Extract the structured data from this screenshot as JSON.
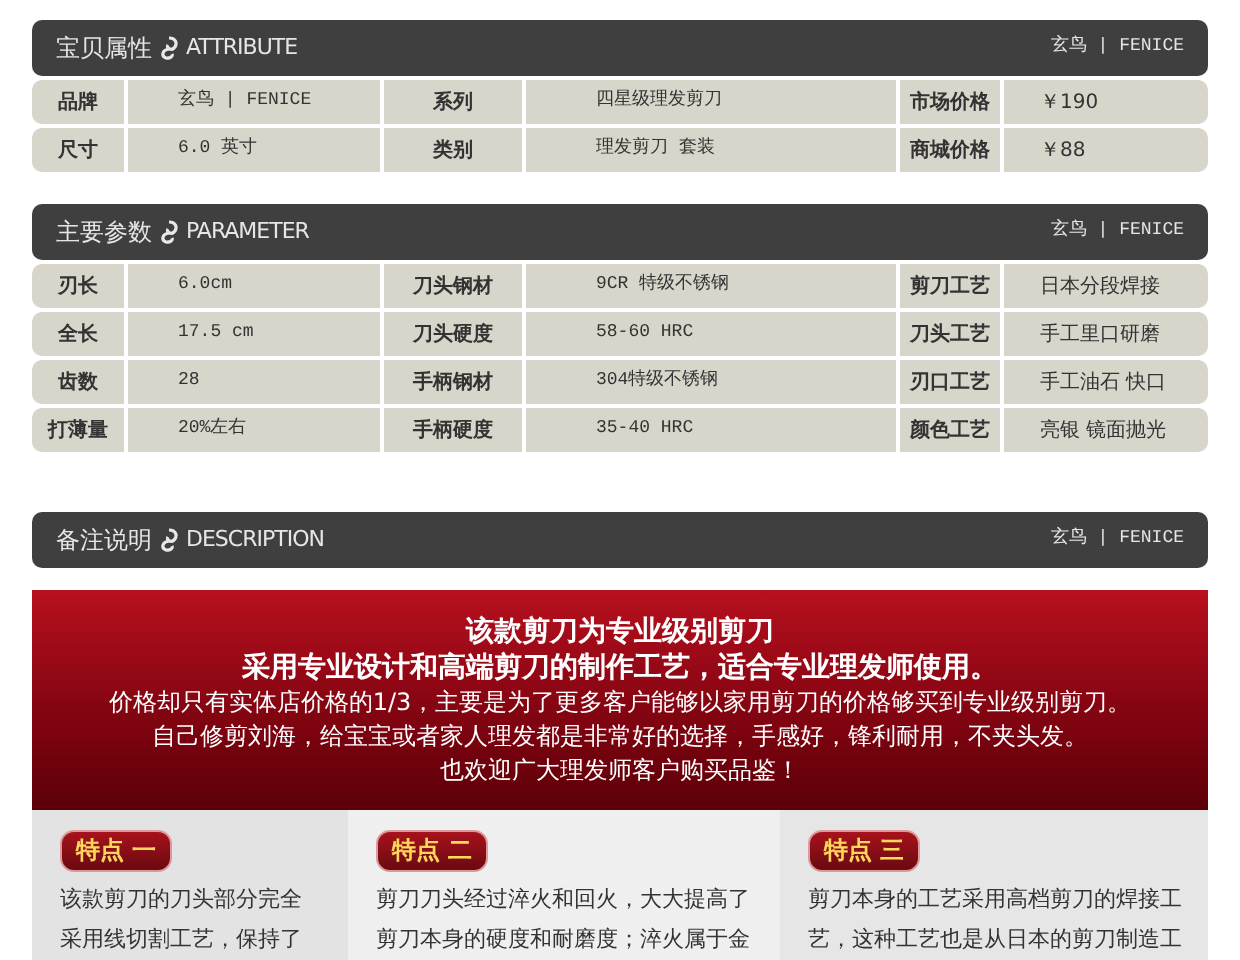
{
  "sections": [
    {
      "title_cn": "宝贝属性",
      "title_en": "ATTRIBUTE",
      "brand": "玄鸟 | FENICE",
      "rows": [
        {
          "cells": [
            "品牌",
            "玄鸟 | FENICE",
            "系列",
            "四星级理发剪刀",
            "市场价格",
            "￥190"
          ]
        },
        {
          "cells": [
            "尺寸",
            "6.0 英寸",
            "类别",
            "理发剪刀 套装",
            "商城价格",
            "￥88"
          ]
        }
      ]
    },
    {
      "title_cn": "主要参数",
      "title_en": "PARAMETER",
      "brand": "玄鸟 | FENICE",
      "rows": [
        {
          "cells": [
            "刃长",
            "6.0cm",
            "刀头钢材",
            "9CR 特级不锈钢",
            "剪刀工艺",
            "日本分段焊接"
          ]
        },
        {
          "cells": [
            "全长",
            "17.5 cm",
            "刀头硬度",
            "58-60 HRC",
            "刀头工艺",
            "手工里口研磨"
          ]
        },
        {
          "cells": [
            "齿数",
            "28",
            "手柄钢材",
            "304特级不锈钢",
            "刃口工艺",
            "手工油石 快口"
          ]
        },
        {
          "cells": [
            "打薄量",
            "20%左右",
            "手柄硬度",
            "35-40 HRC",
            "颜色工艺",
            "亮银 镜面抛光"
          ]
        }
      ]
    },
    {
      "title_cn": "备注说明",
      "title_en": "DESCRIPTION",
      "brand": "玄鸟 | FENICE"
    }
  ],
  "banner": {
    "headlines": [
      "该款剪刀为专业级别剪刀",
      "采用专业设计和高端剪刀的制作工艺，适合专业理发师使用。"
    ],
    "lines": [
      "价格却只有实体店价格的1/3，主要是为了更多客户能够以家用剪刀的价格够买到专业级别剪刀。",
      "自己修剪刘海，给宝宝或者家人理发都是非常好的选择，手感好，锋利耐用，不夹头发。",
      "也欢迎广大理发师客户购买品鉴！"
    ]
  },
  "features": [
    {
      "badge": "特点 一",
      "lines": [
        "该款剪刀的刀头部分完全",
        "采用线切割工艺，保持了"
      ]
    },
    {
      "badge": "特点 二",
      "lines": [
        "剪刀刀头经过淬火和回火，大大提高了",
        "剪刀本身的硬度和耐磨度；淬火属于金"
      ]
    },
    {
      "badge": "特点 三",
      "lines": [
        "剪刀本身的工艺采用高档剪刀的焊接工",
        "艺，这种工艺也是从日本的剪刀制造工"
      ]
    }
  ]
}
